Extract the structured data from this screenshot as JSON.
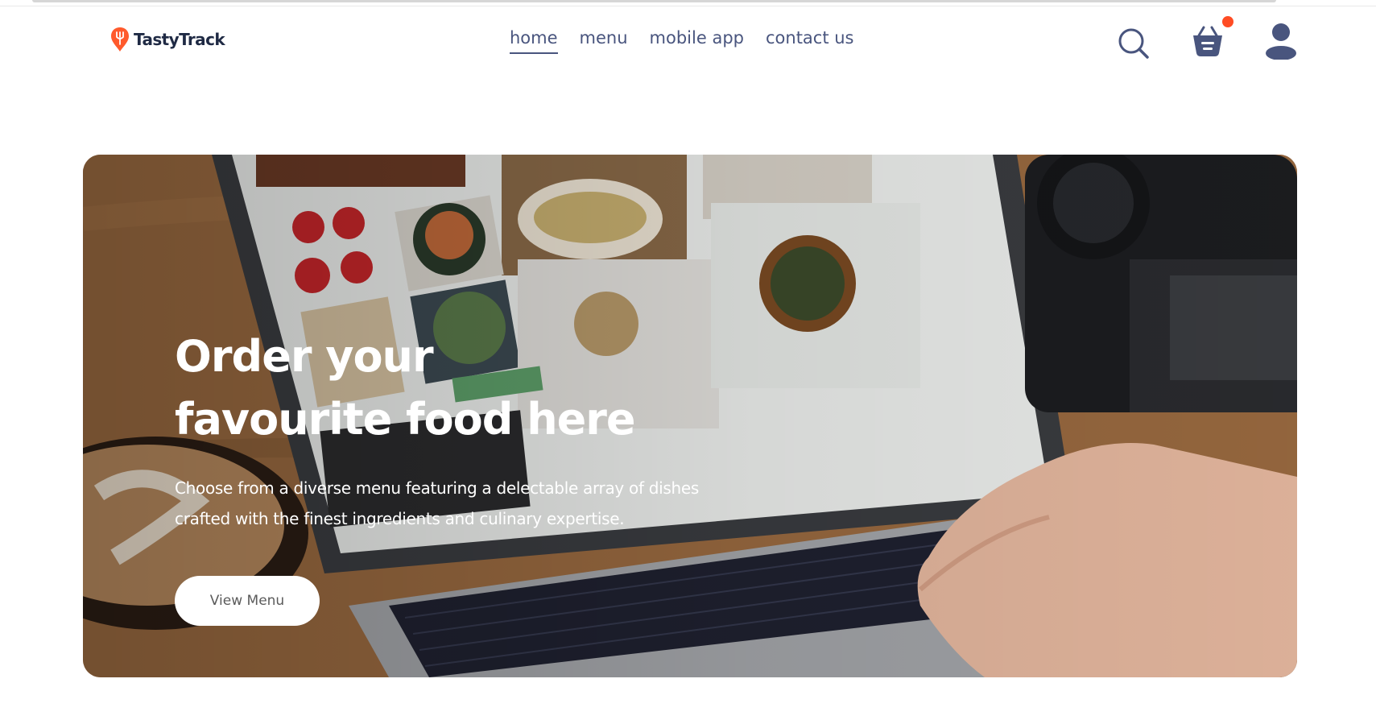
{
  "brand": {
    "name": "TastyTrack"
  },
  "nav": {
    "items": [
      {
        "label": "home",
        "active": true
      },
      {
        "label": "menu",
        "active": false
      },
      {
        "label": "mobile app",
        "active": false
      },
      {
        "label": "contact us",
        "active": false
      }
    ]
  },
  "header_icons": {
    "search": "search-icon",
    "basket": "basket-icon",
    "basket_has_notification": true,
    "profile": "profile-icon"
  },
  "hero": {
    "title_line1": "Order your",
    "title_line2": "favourite food here",
    "description": "Choose from a diverse menu featuring a delectable array of dishes crafted with the finest ingredients and culinary expertise.",
    "button_label": "View Menu"
  },
  "colors": {
    "text_primary": "#49557e",
    "brand_dark": "#1f2a44",
    "accent": "#ff4c24",
    "hero_button_bg": "#ffffff"
  }
}
